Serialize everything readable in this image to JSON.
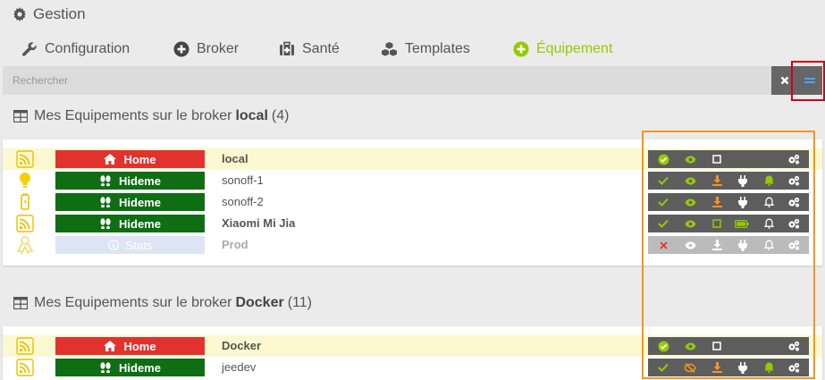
{
  "header": {
    "title": "Gestion",
    "icon": "cog-icon"
  },
  "tabs": [
    {
      "label": "Configuration",
      "icon": "wrench-icon",
      "active": false
    },
    {
      "label": "Broker",
      "icon": "plus-circle-icon",
      "active": false
    },
    {
      "label": "Santé",
      "icon": "medkit-icon",
      "active": false
    },
    {
      "label": "Templates",
      "icon": "cubes-icon",
      "active": false
    },
    {
      "label": "Équipement",
      "icon": "plus-circle-icon",
      "active": true
    }
  ],
  "search": {
    "placeholder": "Rechercher",
    "value": ""
  },
  "colors": {
    "accent": "#94ca02",
    "home": "#e1322e",
    "hideme": "#0f6e14",
    "highlight": "#fcf8d0",
    "action_bar": "#5d5d5d",
    "orange": "#f7941d"
  },
  "sections": [
    {
      "prefix": "Mes Equipements sur le broker",
      "broker": "local",
      "count": "(4)",
      "rows": [
        {
          "icon": "rss-icon",
          "object": "Home",
          "object_color": "red",
          "name": "local",
          "highlight": true
        },
        {
          "icon": "lightbulb-icon",
          "object": "Hideme",
          "object_color": "green",
          "name": "sonoff-1",
          "highlight": false
        },
        {
          "icon": "plug-icon",
          "object": "Hideme",
          "object_color": "green",
          "name": "sonoff-2",
          "highlight": false
        },
        {
          "icon": "rss-icon",
          "object": "Hideme",
          "object_color": "green",
          "name": "Xiaomi Mi Jia",
          "highlight": false
        },
        {
          "icon": "ribbon-icon",
          "object": "Stats",
          "object_color": "grey",
          "name": "Prod",
          "highlight": false
        }
      ]
    },
    {
      "prefix": "Mes Equipements sur le broker",
      "broker": "Docker",
      "count": "(11)",
      "rows": [
        {
          "icon": "rss-icon",
          "object": "Home",
          "object_color": "red",
          "name": "Docker",
          "highlight": true
        },
        {
          "icon": "rss-icon",
          "object": "Hideme",
          "object_color": "green",
          "name": "jeedev",
          "highlight": false
        }
      ]
    }
  ]
}
